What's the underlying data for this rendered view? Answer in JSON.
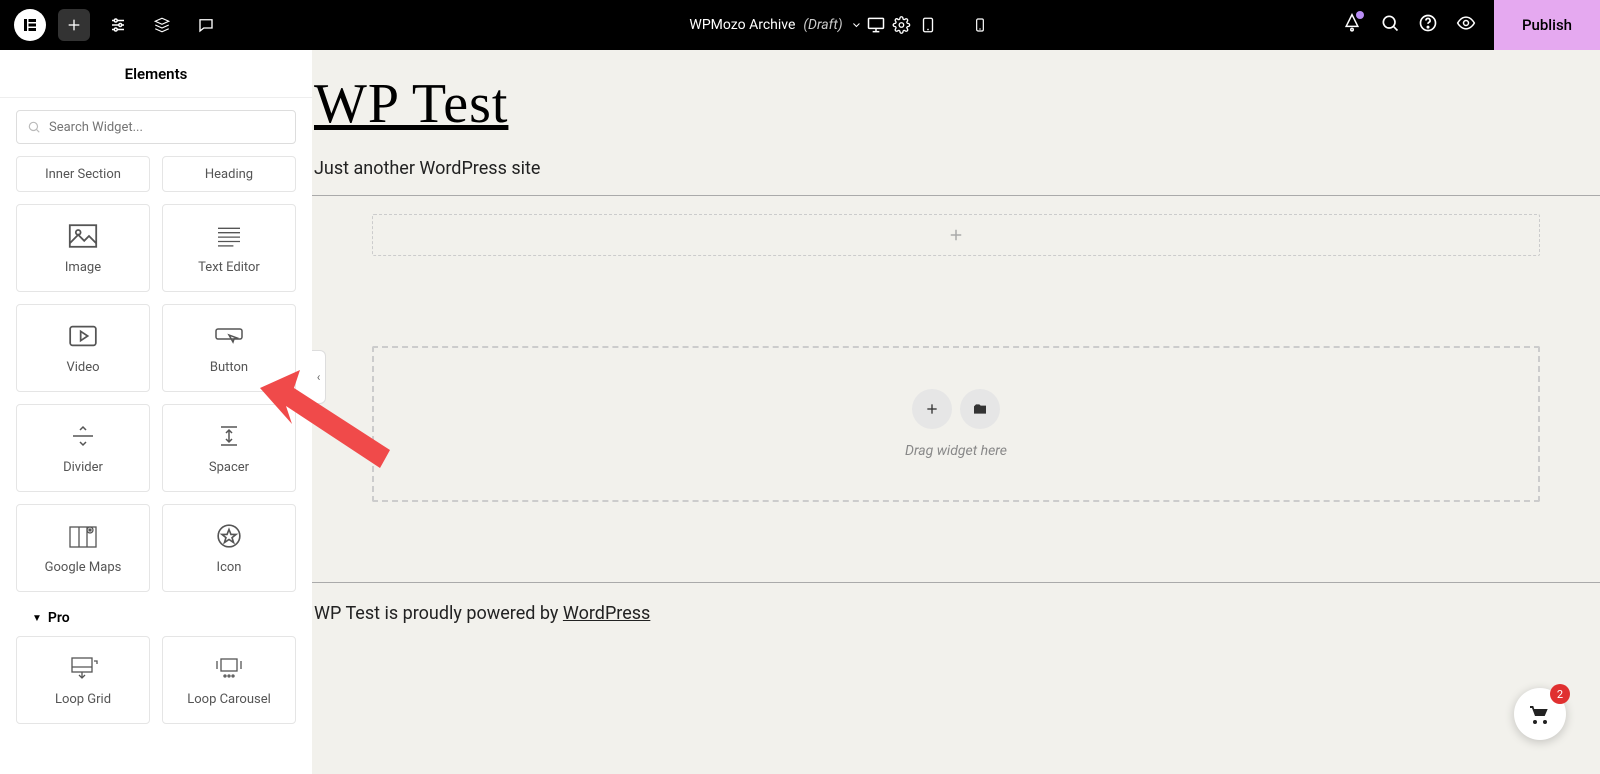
{
  "topbar": {
    "page_name": "WPMozo Archive",
    "draft_label": "(Draft)",
    "publish_label": "Publish"
  },
  "sidebar": {
    "title": "Elements",
    "search_placeholder": "Search Widget...",
    "widgets_top": [
      {
        "label": "Inner Section"
      },
      {
        "label": "Heading"
      }
    ],
    "widgets": [
      {
        "label": "Image",
        "icon": "image"
      },
      {
        "label": "Text Editor",
        "icon": "text"
      },
      {
        "label": "Video",
        "icon": "video"
      },
      {
        "label": "Button",
        "icon": "button"
      },
      {
        "label": "Divider",
        "icon": "divider"
      },
      {
        "label": "Spacer",
        "icon": "spacer"
      },
      {
        "label": "Google Maps",
        "icon": "map"
      },
      {
        "label": "Icon",
        "icon": "star"
      }
    ],
    "pro_title": "Pro",
    "pro_widgets": [
      {
        "label": "Loop Grid",
        "icon": "loopgrid"
      },
      {
        "label": "Loop Carousel",
        "icon": "loopcarousel"
      }
    ]
  },
  "canvas": {
    "site_title": "WP Test",
    "tagline": "Just another WordPress site",
    "drag_hint": "Drag widget here",
    "footer_prefix": "WP Test is proudly powered by ",
    "footer_link": "WordPress"
  },
  "cart": {
    "count": "2"
  }
}
